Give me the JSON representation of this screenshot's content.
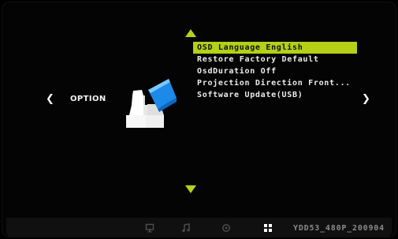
{
  "header": {
    "up_indicator_icon": "triangle-up-icon",
    "down_indicator_icon": "triangle-down-icon"
  },
  "page": {
    "title": "OPTION",
    "left_nav_icon": "chevron-left-icon",
    "right_nav_icon": "chevron-right-icon",
    "left_nav_symbol": "❮",
    "right_nav_symbol": "❯",
    "category_icon": "option-icon"
  },
  "menu": {
    "items": [
      {
        "label": "OSD Language English",
        "selected": true
      },
      {
        "label": "Restore Factory Default",
        "selected": false
      },
      {
        "label": "OsdDuration Off",
        "selected": false
      },
      {
        "label": "Projection Direction Front...",
        "selected": false
      },
      {
        "label": "Software Update(USB)",
        "selected": false
      }
    ]
  },
  "bottom_bar": {
    "tabs": [
      {
        "icon": "monitor-icon",
        "active": false
      },
      {
        "icon": "music-note-icon",
        "active": false
      },
      {
        "icon": "settings-icon",
        "active": false
      },
      {
        "icon": "grid-icon",
        "active": true
      }
    ],
    "firmware_label": "YDD53_480P_200904"
  },
  "colors": {
    "accent": "#b4d017",
    "background": "#000000",
    "text_primary": "#ececec",
    "text_muted": "#8a8a8a"
  }
}
